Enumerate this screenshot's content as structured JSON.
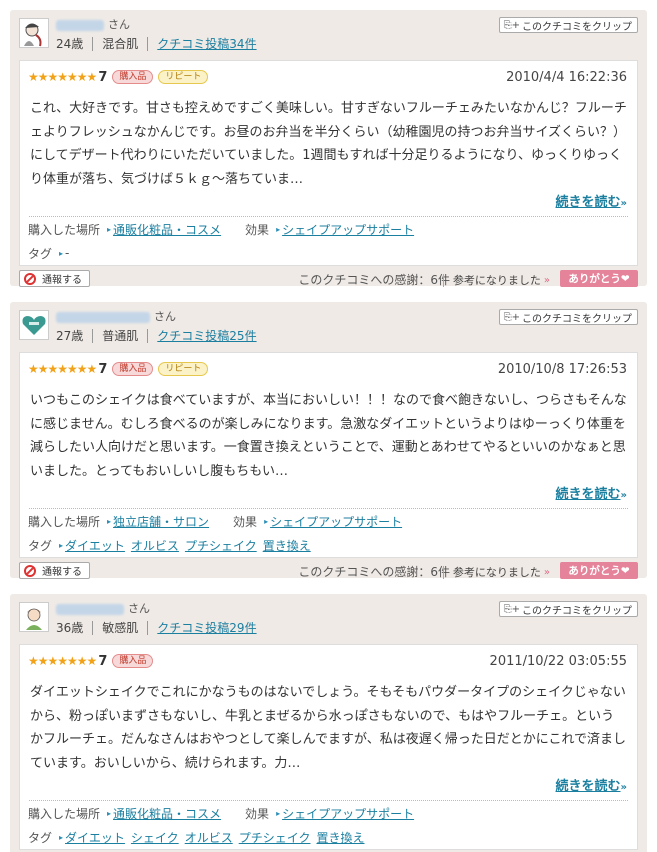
{
  "labels": {
    "san": "さん",
    "clip": "このクチコミをクリップ",
    "place_label": "購入した場所",
    "effect_label": "効果",
    "tag_label": "タグ",
    "read_more": "続きを読む",
    "report": "通報する",
    "helpful": "参考になりました",
    "thanks_button": "ありがとう"
  },
  "reviews": [
    {
      "age": "24歳",
      "skin": "混合肌",
      "posts": "クチコミ投稿34件",
      "stars": "★★★★★★★",
      "score": "7",
      "badges": [
        "購入品",
        "リピート"
      ],
      "date": "2010/4/4 16:22:36",
      "text": "これ、大好きです。甘さも控えめですごく美味しい。甘すぎないフルーチェみたいなかんじ？フルーチェよりフレッシュなかんじです。お昼のお弁当を半分くらい（幼稚園児の持つお弁当サイズくらい？）にしてデザート代わりにいただいていました。1週間もすれば十分足りるようになり、ゆっくりゆっくり体重が落ち、気づけば５ｋｇ～落ちていま…",
      "place": "通販化粧品・コスメ",
      "effect": "シェイプアップサポート",
      "tags": [
        "-"
      ],
      "thanks": "このクチコミへの感謝：6件"
    },
    {
      "age": "27歳",
      "skin": "普通肌",
      "posts": "クチコミ投稿25件",
      "stars": "★★★★★★★",
      "score": "7",
      "badges": [
        "購入品",
        "リピート"
      ],
      "date": "2010/10/8 17:26:53",
      "text": "いつもこのシェイクは食べていますが、本当においしい！！！なので食べ飽きないし、つらさもそんなに感じません。むしろ食べるのが楽しみになります。急激なダイエットというよりはゆーっくり体重を減らしたい人向けだと思います。一食置き換えということで、運動とあわせてやるといいのかなぁと思いました。とってもおいしいし腹もちもい…",
      "place": "独立店舗・サロン",
      "effect": "シェイプアップサポート",
      "tags": [
        "ダイエット",
        "オルビス",
        "プチシェイク",
        "置き換え"
      ],
      "thanks": "このクチコミへの感謝：6件"
    },
    {
      "age": "36歳",
      "skin": "敏感肌",
      "posts": "クチコミ投稿29件",
      "stars": "★★★★★★★",
      "score": "7",
      "badges": [
        "購入品"
      ],
      "date": "2011/10/22 03:05:55",
      "text": "ダイエットシェイクでこれにかなうものはないでしょう。そもそもパウダータイプのシェイクじゃないから、粉っぽいまずさもないし、牛乳とまぜるから水っぽさもないので、もはやフルーチェ。というかフルーチェ。だんなさんはおやつとして楽しんでますが、私は夜遅く帰った日だとかにこれで済ましています。おいしいから、続けられます。力…",
      "place": "通販化粧品・コスメ",
      "effect": "シェイプアップサポート",
      "tags": [
        "ダイエット",
        "シェイク",
        "オルビス",
        "プチシェイク",
        "置き換え"
      ]
    }
  ]
}
